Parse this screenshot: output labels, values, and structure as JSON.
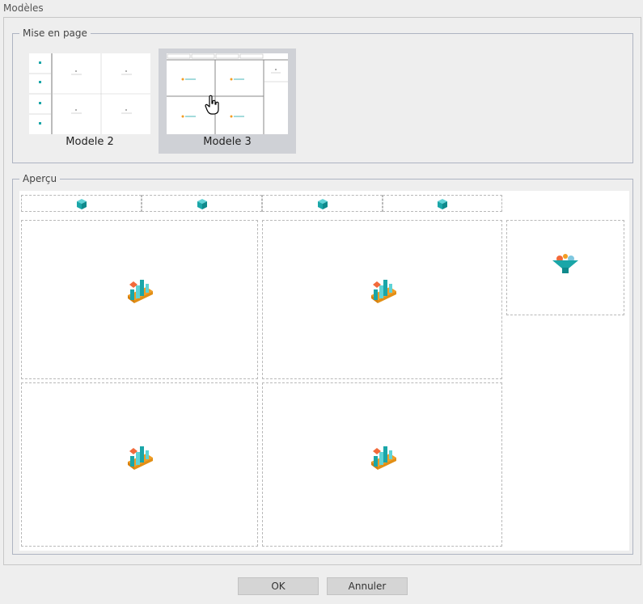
{
  "window": {
    "title": "Modèles"
  },
  "layout_group": {
    "legend": "Mise en page",
    "models": [
      {
        "label": "Modele 2",
        "selected": false
      },
      {
        "label": "Modele 3",
        "selected": true
      }
    ]
  },
  "preview_group": {
    "legend": "Aperçu"
  },
  "buttons": {
    "ok": "OK",
    "cancel": "Annuler"
  },
  "icons": {
    "filter_cells": "cube-icon",
    "chart_cells": "chart-icon",
    "side_cell": "funnel-icon",
    "cursor": "hand-pointer-icon"
  },
  "colors": {
    "teal": "#1aa6a8",
    "orange": "#f29d23",
    "selected_bg": "#cfd1d6"
  }
}
